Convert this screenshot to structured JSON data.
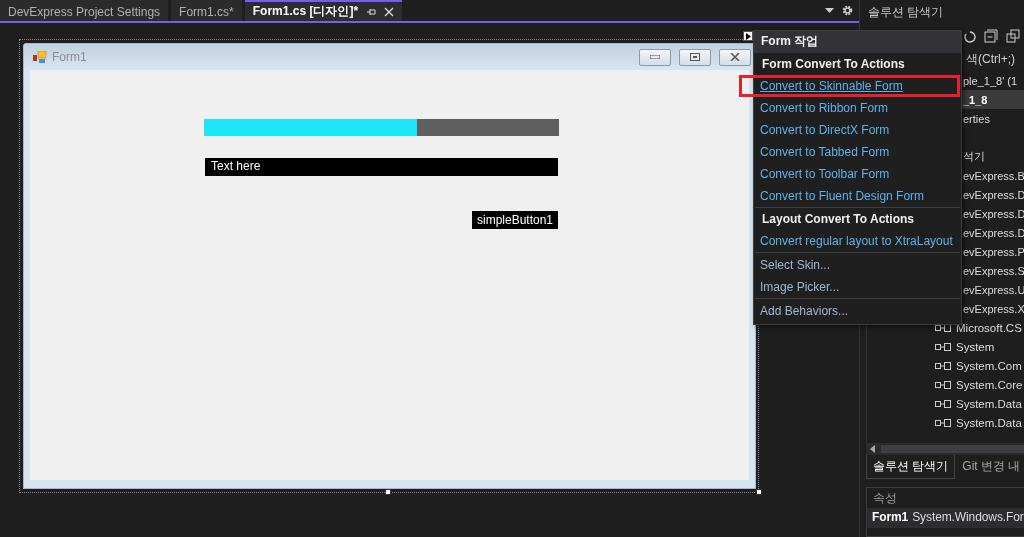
{
  "tabs": [
    {
      "label": "DevExpress Project Settings",
      "selected": false
    },
    {
      "label": "Form1.cs*",
      "selected": false
    },
    {
      "label": "Form1.cs [디자인]*",
      "selected": true
    }
  ],
  "form": {
    "title": "Form1",
    "progress": {
      "level": 0.6
    },
    "text_edit": {
      "value": "Text here"
    },
    "button": {
      "label": "simpleButton1"
    }
  },
  "action_menu": {
    "title": "Form 작업",
    "sections": [
      {
        "title": "Form Convert To Actions",
        "items": [
          {
            "label": "Convert to Skinnable Form",
            "kind": "link",
            "selected": true
          },
          {
            "label": "Convert to Ribbon Form",
            "kind": "link",
            "selected": false
          },
          {
            "label": "Convert to DirectX Form",
            "kind": "link",
            "selected": false
          },
          {
            "label": "Convert to Tabbed Form",
            "kind": "link",
            "selected": false
          },
          {
            "label": "Convert to Toolbar Form",
            "kind": "link",
            "selected": false
          },
          {
            "label": "Convert to Fluent Design Form",
            "kind": "link",
            "selected": false
          }
        ]
      },
      {
        "title": "Layout Convert To Actions",
        "items": [
          {
            "label": "Convert regular layout to XtraLayout",
            "kind": "link",
            "selected": false
          }
        ]
      },
      {
        "items": [
          {
            "label": "Select Skin...",
            "kind": "command",
            "selected": false
          },
          {
            "label": "Image Picker...",
            "kind": "command",
            "selected": false
          }
        ]
      },
      {
        "items": [
          {
            "label": "Add Behaviors...",
            "kind": "command",
            "selected": false
          }
        ]
      }
    ]
  },
  "solution_explorer": {
    "title": "솔루션 탐색기",
    "search": {
      "placeholder": "색(Ctrl+;)"
    },
    "items": [
      {
        "label": "ple_1_8'  (1",
        "kind": "text",
        "selected": false
      },
      {
        "label": "_1_8",
        "kind": "text",
        "selected": true
      },
      {
        "label": "erties",
        "kind": "text",
        "selected": false
      },
      {
        "kind": "blank",
        "selected": false
      },
      {
        "label": "석기",
        "kind": "text",
        "selected": false
      },
      {
        "label": "evExpress.B",
        "kind": "text",
        "selected": false
      },
      {
        "label": "evExpress.D",
        "kind": "text",
        "selected": false
      },
      {
        "label": "evExpress.D",
        "kind": "text",
        "selected": false
      },
      {
        "label": "evExpress.D",
        "kind": "text",
        "selected": false
      },
      {
        "label": "evExpress.P",
        "kind": "text",
        "selected": false
      },
      {
        "label": "evExpress.S",
        "kind": "text",
        "selected": false
      },
      {
        "label": "evExpress.U",
        "kind": "text",
        "selected": false
      },
      {
        "label": "evExpress.X",
        "kind": "text",
        "selected": false
      },
      {
        "label": "Microsoft.CS",
        "kind": "reference",
        "selected": false
      },
      {
        "label": "System",
        "kind": "reference",
        "selected": false
      },
      {
        "label": "System.Com",
        "kind": "reference",
        "selected": false
      },
      {
        "label": "System.Core",
        "kind": "reference",
        "selected": false
      },
      {
        "label": "System.Data",
        "kind": "reference",
        "selected": false
      },
      {
        "label": "System.Data",
        "kind": "reference",
        "selected": false
      }
    ]
  },
  "bottom_tabs": [
    {
      "label": "솔루션 탐색기",
      "selected": true
    },
    {
      "label": "Git 변경 내",
      "selected": false
    }
  ],
  "properties": {
    "title": "속성",
    "object": "Form1",
    "type": "System.Windows.For"
  }
}
